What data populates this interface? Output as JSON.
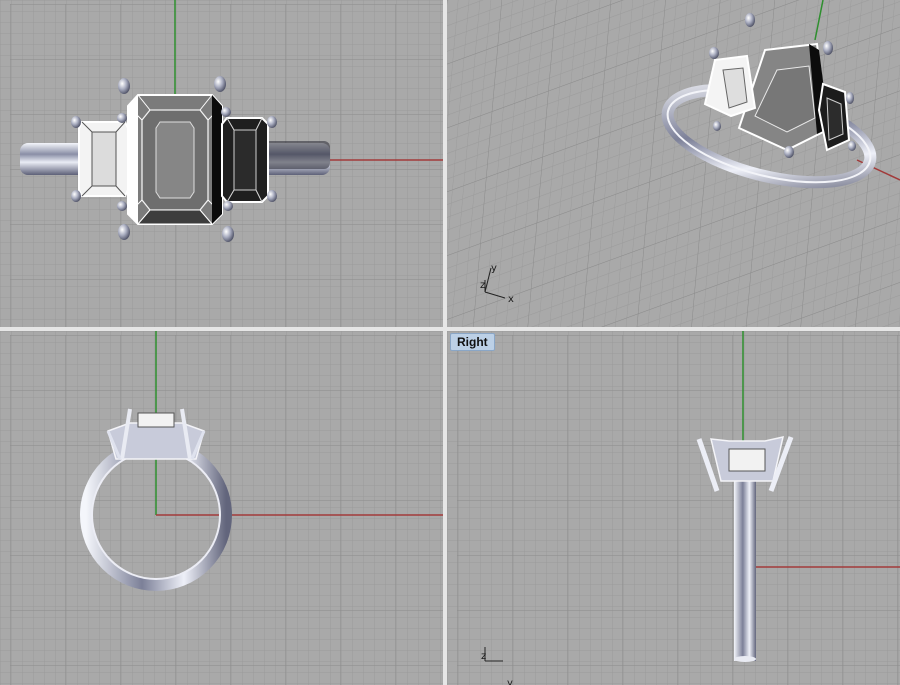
{
  "viewports": {
    "top": {
      "label": ""
    },
    "perspective": {
      "label": "",
      "axis_x": "x",
      "axis_y": "y",
      "axis_z": "z"
    },
    "front": {
      "label": ""
    },
    "right": {
      "label": "Right",
      "axis_z": "z",
      "axis_y": "y"
    }
  },
  "colors": {
    "background": "#a9a9a9",
    "grid_minor": "#9b9b9b",
    "grid_major": "#8b8b8b",
    "axis_x": "#a23a3a",
    "axis_y": "#2f8f2f",
    "label_bg": "#bcd0e6"
  }
}
